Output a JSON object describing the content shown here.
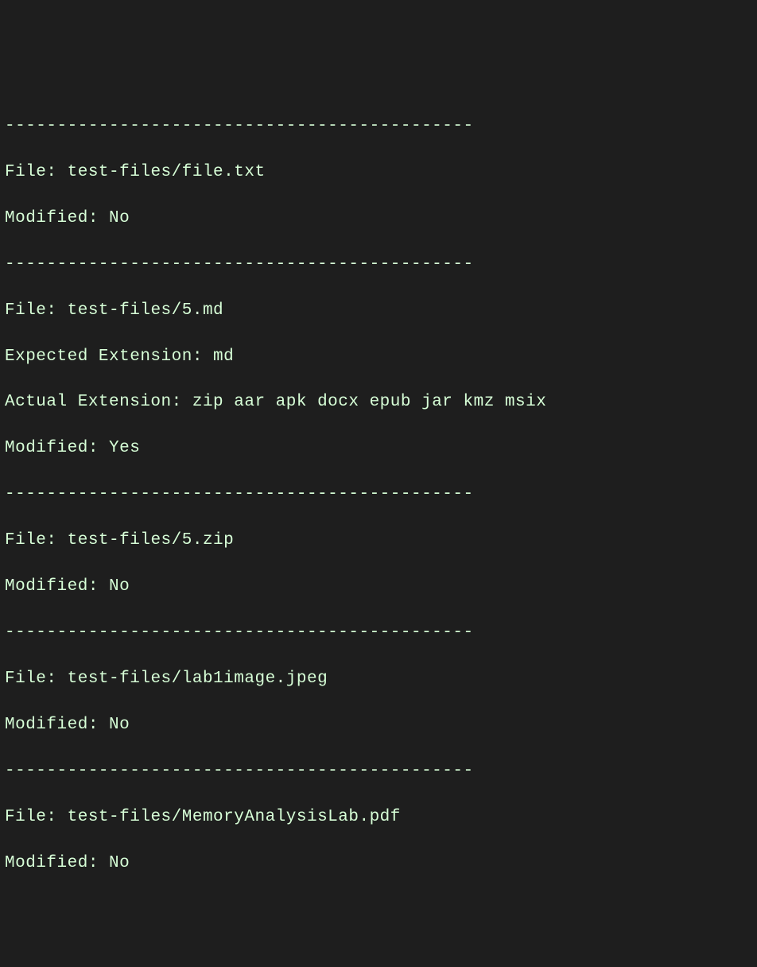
{
  "divider": "---------------------------------------------",
  "labels": {
    "file": "File: ",
    "modified": "Modified: ",
    "expected": "Expected Extension: ",
    "actual": "Actual Extension: "
  },
  "entries": [
    {
      "file": "test-files/file.txt",
      "modified": "No"
    },
    {
      "file": "test-files/5.md",
      "expected": "md",
      "actual": "zip aar apk docx epub jar kmz msix",
      "modified": "Yes"
    },
    {
      "file": "test-files/5.zip",
      "modified": "No"
    },
    {
      "file": "test-files/lab1image.jpeg",
      "modified": "No"
    },
    {
      "file": "test-files/MemoryAnalysisLab.pdf",
      "modified": "No"
    }
  ]
}
